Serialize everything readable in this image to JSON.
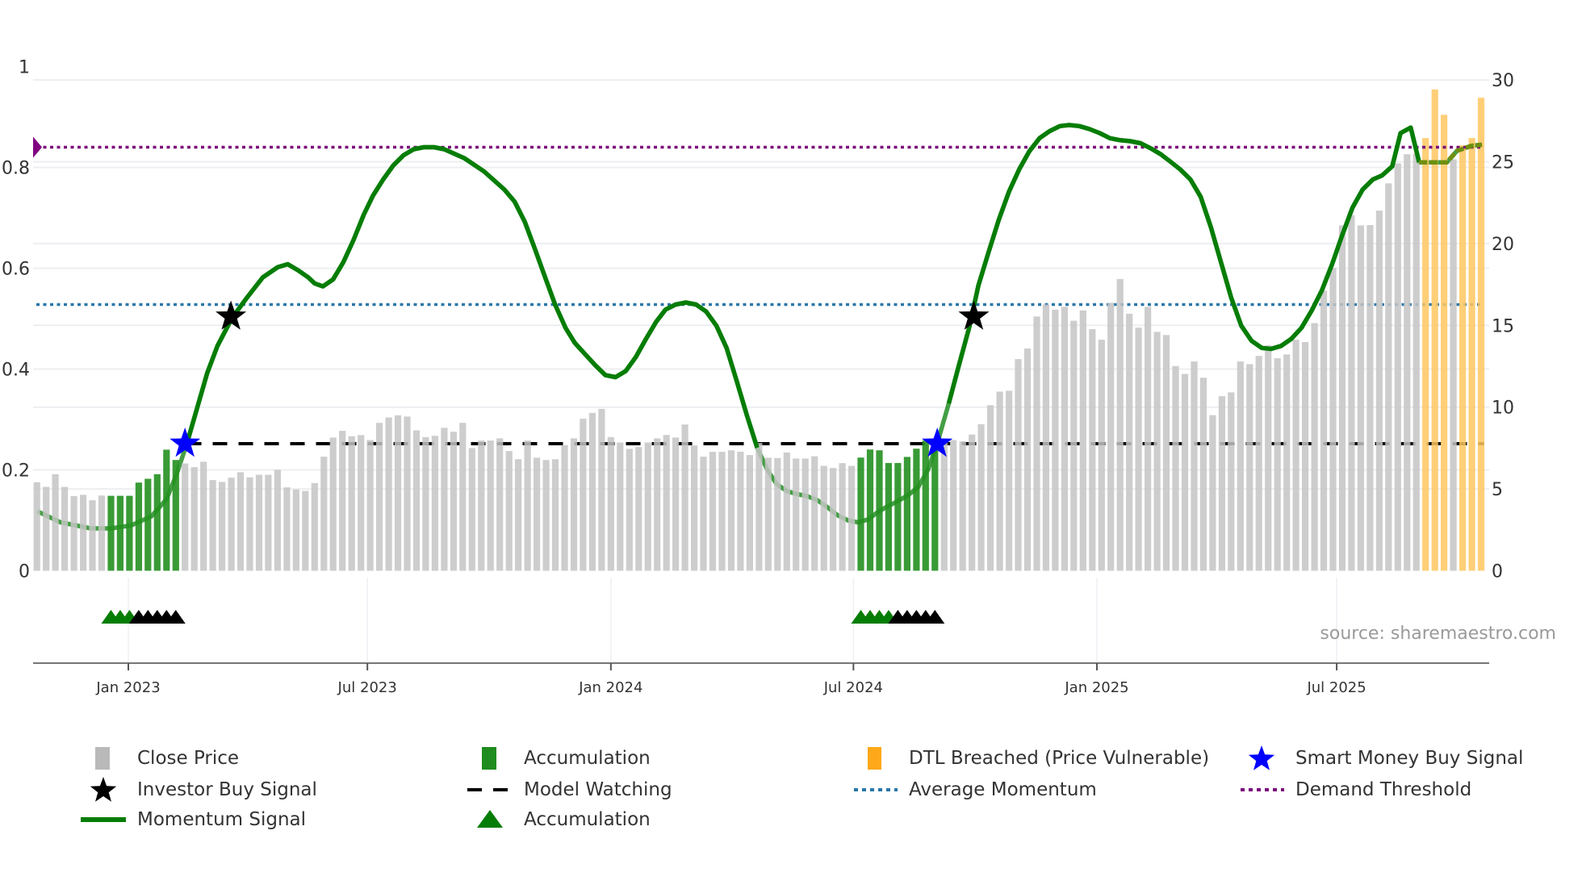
{
  "chart_data": {
    "type": "bar+line",
    "x_unit": "weeks from first bar",
    "x_ticks": [
      {
        "label": "Jan 2023",
        "week": 9.88
      },
      {
        "label": "Jul 2023",
        "week": 35.7
      },
      {
        "label": "Jan 2024",
        "week": 62.0
      },
      {
        "label": "Jul 2024",
        "week": 88.2
      },
      {
        "label": "Jan 2025",
        "week": 114.5
      },
      {
        "label": "Jul 2025",
        "week": 140.4
      }
    ],
    "left_axis": {
      "range": [
        0,
        1
      ],
      "ticks": [
        "0",
        "0.2",
        "0.4",
        "0.6",
        "0.8",
        "1"
      ],
      "tick_values": [
        0,
        0.2,
        0.4,
        0.6,
        0.8,
        1
      ]
    },
    "right_axis": {
      "range": [
        0,
        30
      ],
      "ticks": [
        "0",
        "5",
        "10",
        "15",
        "20",
        "25",
        "30"
      ],
      "tick_values": [
        0,
        5,
        10,
        15,
        20,
        25,
        30
      ]
    },
    "close_price": [
      5.41,
      5.13,
      5.9,
      5.13,
      4.56,
      4.64,
      4.31,
      4.6,
      4.58,
      4.58,
      4.58,
      5.39,
      5.62,
      5.9,
      7.4,
      6.77,
      6.56,
      6.33,
      6.66,
      5.54,
      5.43,
      5.69,
      6.02,
      5.71,
      5.87,
      5.87,
      6.17,
      5.1,
      4.97,
      4.88,
      5.36,
      6.97,
      8.14,
      8.55,
      8.22,
      8.29,
      7.99,
      9.04,
      9.37,
      9.5,
      9.43,
      8.58,
      8.17,
      8.25,
      8.74,
      8.5,
      9.04,
      7.5,
      7.96,
      7.96,
      8.09,
      7.32,
      6.82,
      7.96,
      6.91,
      6.77,
      6.82,
      7.68,
      8.09,
      9.29,
      9.65,
      9.89,
      8.17,
      7.84,
      7.45,
      7.56,
      7.84,
      8.09,
      8.3,
      8.14,
      8.94,
      7.66,
      6.97,
      7.27,
      7.27,
      7.36,
      7.28,
      7.07,
      7.81,
      6.91,
      6.89,
      7.23,
      6.86,
      6.86,
      7.0,
      6.41,
      6.28,
      6.58,
      6.41,
      6.92,
      7.41,
      7.36,
      6.59,
      6.59,
      6.96,
      7.46,
      7.96,
      7.8,
      7.99,
      7.99,
      7.91,
      8.33,
      8.96,
      10.12,
      10.95,
      11.0,
      12.94,
      13.59,
      15.54,
      16.27,
      15.96,
      16.13,
      15.28,
      15.91,
      14.77,
      14.12,
      16.38,
      17.83,
      15.71,
      14.86,
      16.13,
      14.6,
      14.41,
      12.51,
      12.03,
      12.79,
      11.8,
      9.51,
      10.67,
      10.9,
      12.79,
      12.63,
      13.13,
      13.78,
      12.99,
      13.22,
      14.12,
      13.98,
      15.14,
      17.12,
      18.51,
      21.11,
      21.73,
      21.11,
      21.13,
      22.01,
      23.68,
      24.9,
      25.46,
      25.5,
      26.45,
      29.42,
      27.87,
      25.15,
      26.0,
      26.45,
      28.91
    ],
    "accumulation_weeks": [
      [
        8,
        15
      ],
      [
        89,
        97
      ]
    ],
    "dtl_breached_weeks": [
      150,
      151,
      152,
      154,
      155,
      156
    ],
    "momentum": [
      [
        0.05,
        0.118
      ],
      [
        2.56,
        0.096
      ],
      [
        5.83,
        0.084
      ],
      [
        8.01,
        0.084
      ],
      [
        10.19,
        0.09
      ],
      [
        12.37,
        0.108
      ],
      [
        14.0,
        0.142
      ],
      [
        15.1,
        0.192
      ],
      [
        16.2,
        0.252
      ],
      [
        17.3,
        0.322
      ],
      [
        18.4,
        0.392
      ],
      [
        19.5,
        0.446
      ],
      [
        21.1,
        0.502
      ],
      [
        22.7,
        0.542
      ],
      [
        24.4,
        0.582
      ],
      [
        26.0,
        0.602
      ],
      [
        27.1,
        0.608
      ],
      [
        28.2,
        0.596
      ],
      [
        29.3,
        0.582
      ],
      [
        30.0,
        0.57
      ],
      [
        30.9,
        0.564
      ],
      [
        32.0,
        0.578
      ],
      [
        33.1,
        0.612
      ],
      [
        34.2,
        0.656
      ],
      [
        35.3,
        0.706
      ],
      [
        36.3,
        0.744
      ],
      [
        37.4,
        0.776
      ],
      [
        38.5,
        0.804
      ],
      [
        39.6,
        0.824
      ],
      [
        40.7,
        0.836
      ],
      [
        41.8,
        0.84
      ],
      [
        42.9,
        0.84
      ],
      [
        44.0,
        0.836
      ],
      [
        46.2,
        0.818
      ],
      [
        48.3,
        0.792
      ],
      [
        50.5,
        0.756
      ],
      [
        51.6,
        0.732
      ],
      [
        52.7,
        0.692
      ],
      [
        53.8,
        0.638
      ],
      [
        54.9,
        0.582
      ],
      [
        55.97,
        0.528
      ],
      [
        57.1,
        0.482
      ],
      [
        58.1,
        0.452
      ],
      [
        59.2,
        0.43
      ],
      [
        60.3,
        0.408
      ],
      [
        61.4,
        0.388
      ],
      [
        62.5,
        0.384
      ],
      [
        63.6,
        0.396
      ],
      [
        64.7,
        0.424
      ],
      [
        65.8,
        0.46
      ],
      [
        66.9,
        0.494
      ],
      [
        67.9,
        0.518
      ],
      [
        69.0,
        0.528
      ],
      [
        70.1,
        0.532
      ],
      [
        71.2,
        0.528
      ],
      [
        72.3,
        0.514
      ],
      [
        73.4,
        0.486
      ],
      [
        74.5,
        0.442
      ],
      [
        75.6,
        0.376
      ],
      [
        76.7,
        0.308
      ],
      [
        77.8,
        0.244
      ],
      [
        78.9,
        0.2
      ],
      [
        79.9,
        0.172
      ],
      [
        81.0,
        0.158
      ],
      [
        82.1,
        0.152
      ],
      [
        83.2,
        0.148
      ],
      [
        84.3,
        0.14
      ],
      [
        85.4,
        0.126
      ],
      [
        86.5,
        0.11
      ],
      [
        87.6,
        0.1
      ],
      [
        88.7,
        0.096
      ],
      [
        89.8,
        0.102
      ],
      [
        90.8,
        0.116
      ],
      [
        91.9,
        0.128
      ],
      [
        93.0,
        0.138
      ],
      [
        94.1,
        0.15
      ],
      [
        95.2,
        0.166
      ],
      [
        96.3,
        0.202
      ],
      [
        97.4,
        0.262
      ],
      [
        98.5,
        0.332
      ],
      [
        99.6,
        0.408
      ],
      [
        100.7,
        0.482
      ],
      [
        101.7,
        0.566
      ],
      [
        102.8,
        0.632
      ],
      [
        103.9,
        0.696
      ],
      [
        105.0,
        0.752
      ],
      [
        106.1,
        0.796
      ],
      [
        107.2,
        0.832
      ],
      [
        108.3,
        0.858
      ],
      [
        109.4,
        0.872
      ],
      [
        110.5,
        0.882
      ],
      [
        111.5,
        0.884
      ],
      [
        112.6,
        0.882
      ],
      [
        113.7,
        0.876
      ],
      [
        114.8,
        0.868
      ],
      [
        115.9,
        0.858
      ],
      [
        117.0,
        0.854
      ],
      [
        118.1,
        0.852
      ],
      [
        119.2,
        0.848
      ],
      [
        120.3,
        0.838
      ],
      [
        121.4,
        0.826
      ],
      [
        122.4,
        0.812
      ],
      [
        123.5,
        0.796
      ],
      [
        124.6,
        0.776
      ],
      [
        125.7,
        0.742
      ],
      [
        126.8,
        0.682
      ],
      [
        127.9,
        0.612
      ],
      [
        129.0,
        0.542
      ],
      [
        130.1,
        0.486
      ],
      [
        131.2,
        0.456
      ],
      [
        132.3,
        0.442
      ],
      [
        133.3,
        0.44
      ],
      [
        134.4,
        0.446
      ],
      [
        135.5,
        0.46
      ],
      [
        136.6,
        0.482
      ],
      [
        137.7,
        0.516
      ],
      [
        138.8,
        0.556
      ],
      [
        139.9,
        0.608
      ],
      [
        141.0,
        0.666
      ],
      [
        142.1,
        0.72
      ],
      [
        143.2,
        0.756
      ],
      [
        144.3,
        0.776
      ],
      [
        145.3,
        0.784
      ],
      [
        146.4,
        0.802
      ],
      [
        147.3,
        0.868
      ],
      [
        148.4,
        0.879
      ],
      [
        149.3,
        0.81
      ],
      [
        152.3,
        0.81
      ],
      [
        153.4,
        0.833
      ],
      [
        155.0,
        0.843
      ],
      [
        156.1,
        0.845
      ]
    ],
    "momentum_weak_ranges": [
      [
        0,
        16.2
      ],
      [
        77.8,
        98.0
      ],
      [
        149.3,
        156.1
      ]
    ],
    "demand_threshold": 0.84,
    "average_momentum": 0.528,
    "model_watching": {
      "level": 0.252,
      "from_week": 16.2
    },
    "smart_money_buy_signals": [
      [
        16.0,
        0.252
      ],
      [
        97.25,
        0.252
      ]
    ],
    "investor_buy_signals": [
      [
        20.96,
        0.504
      ],
      [
        101.2,
        0.504
      ]
    ],
    "accumulation_triangles": {
      "green": [
        8,
        9,
        10,
        89,
        90,
        91,
        92
      ],
      "black": [
        11,
        12,
        13,
        14,
        15,
        93,
        94,
        95,
        96,
        97
      ]
    },
    "colors": {
      "close_price": "#c4c4c4",
      "accumulation": "#23901f",
      "dtl": "#ffc760",
      "dtl_legend": "#ffa91a",
      "momentum": "#067d06",
      "momentum_weak_end": "#6f8f10",
      "smart_money": "#0000ff",
      "investor": "#000000",
      "average_momentum": "#2a77a8",
      "demand_threshold": "#7a0a7a",
      "model_watching": "#000000"
    }
  },
  "source": "source: sharemaestro.com",
  "legend": [
    {
      "label": "Close Price",
      "icon": "gray-square-icon"
    },
    {
      "label": "Accumulation",
      "icon": "green-square-icon"
    },
    {
      "label": "DTL Breached (Price Vulnerable)",
      "icon": "orange-square-icon"
    },
    {
      "label": "Smart Money Buy Signal",
      "icon": "blue-star-icon"
    },
    {
      "label": "Investor Buy Signal",
      "icon": "black-star-icon"
    },
    {
      "label": "Model Watching",
      "icon": "dashed-line-icon"
    },
    {
      "label": "Average Momentum",
      "icon": "blue-dotted-line-icon"
    },
    {
      "label": "Demand Threshold",
      "icon": "purple-dotted-line-icon"
    },
    {
      "label": "Momentum Signal",
      "icon": "green-line-icon"
    },
    {
      "label": "Accumulation",
      "icon": "green-triangle-icon"
    }
  ]
}
